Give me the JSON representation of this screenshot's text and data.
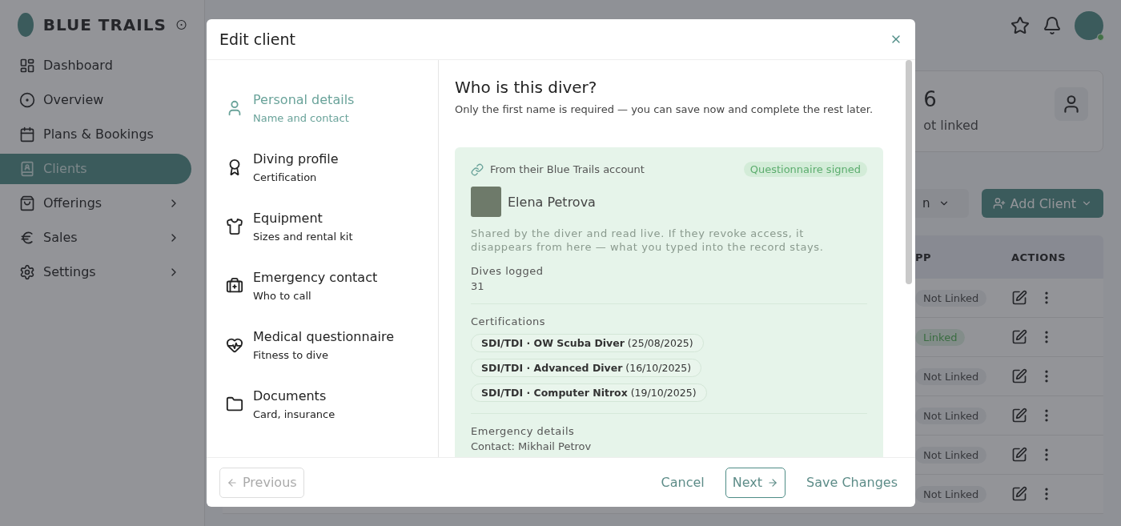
{
  "sidebar": {
    "brand": "BLUE TRAILS",
    "items": [
      {
        "label": "Dashboard",
        "selected": false,
        "has_submenu": false
      },
      {
        "label": "Overview",
        "selected": false,
        "has_submenu": false
      },
      {
        "label": "Plans & Bookings",
        "selected": false,
        "has_submenu": false
      },
      {
        "label": "Clients",
        "selected": true,
        "has_submenu": false
      },
      {
        "label": "Offerings",
        "selected": false,
        "has_submenu": true
      },
      {
        "label": "Sales",
        "selected": false,
        "has_submenu": true
      },
      {
        "label": "Settings",
        "selected": false,
        "has_submenu": true
      }
    ]
  },
  "stats": {
    "value": "6",
    "label": "ot linked"
  },
  "toolbar": {
    "filter_label": "n",
    "add_button": "Add Client"
  },
  "table": {
    "columns": [
      "PP",
      "ACTIONS"
    ],
    "rows": [
      {
        "status": "Not Linked",
        "linked": false
      },
      {
        "status": "Linked",
        "linked": true
      },
      {
        "status": "Not Linked",
        "linked": false
      },
      {
        "status": "Not Linked",
        "linked": false
      },
      {
        "status": "Not Linked",
        "linked": false
      },
      {
        "status": "Not Linked",
        "linked": false
      }
    ]
  },
  "dialog": {
    "title": "Edit client",
    "steps": [
      {
        "title": "Personal details",
        "subtitle": "Name and contact",
        "selected": true
      },
      {
        "title": "Diving profile",
        "subtitle": "Certification",
        "selected": false
      },
      {
        "title": "Equipment",
        "subtitle": "Sizes and rental kit",
        "selected": false
      },
      {
        "title": "Emergency contact",
        "subtitle": "Who to call",
        "selected": false
      },
      {
        "title": "Medical questionnaire",
        "subtitle": "Fitness to dive",
        "selected": false
      },
      {
        "title": "Documents",
        "subtitle": "Card, insurance",
        "selected": false
      }
    ],
    "heading": "Who is this diver?",
    "intro": "Only the first name is required — you can save now and complete the rest later.",
    "card": {
      "source": "From their Blue Trails account",
      "badge": "Questionnaire signed",
      "name": "Elena Petrova",
      "note": "Shared by the diver and read live. If they revoke access, it disappears from here — what you typed into the record stays.",
      "dives_label": "Dives logged",
      "dives_value": "31",
      "certifications_label": "Certifications",
      "certifications": [
        {
          "name": "SDI/TDI · OW Scuba Diver",
          "date": "(25/08/2025)"
        },
        {
          "name": "SDI/TDI · Advanced Diver",
          "date": "(16/10/2025)"
        },
        {
          "name": "SDI/TDI · Computer Nitrox",
          "date": "(19/10/2025)"
        }
      ],
      "emergency_label": "Emergency details",
      "emergency_contact": "Contact: Mikhail Petrov"
    },
    "buttons": {
      "previous": {
        "label": "Previous",
        "disabled": true
      },
      "cancel": "Cancel",
      "next": "Next",
      "save": "Save Changes"
    }
  }
}
